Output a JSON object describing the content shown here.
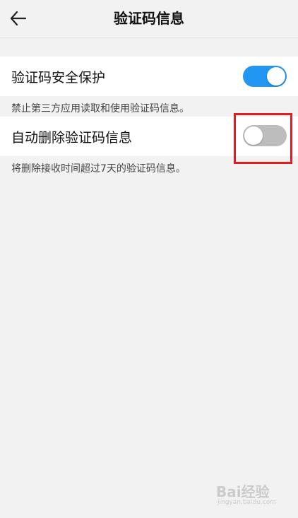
{
  "header": {
    "title": "验证码信息"
  },
  "settings": [
    {
      "label": "验证码安全保护",
      "description": "禁止第三方应用读取和使用验证码信息。",
      "enabled": true
    },
    {
      "label": "自动删除验证码信息",
      "description": "将删除接收时间超过7天的验证码信息。",
      "enabled": false
    }
  ],
  "colors": {
    "toggle_on": "#2196f3",
    "toggle_off": "#bdbdbd",
    "highlight": "#e31b23"
  },
  "icons": {
    "back": "arrow-left-icon"
  },
  "watermark": {
    "text": "Bai经验",
    "sub": "jingyan.baidu.com"
  }
}
